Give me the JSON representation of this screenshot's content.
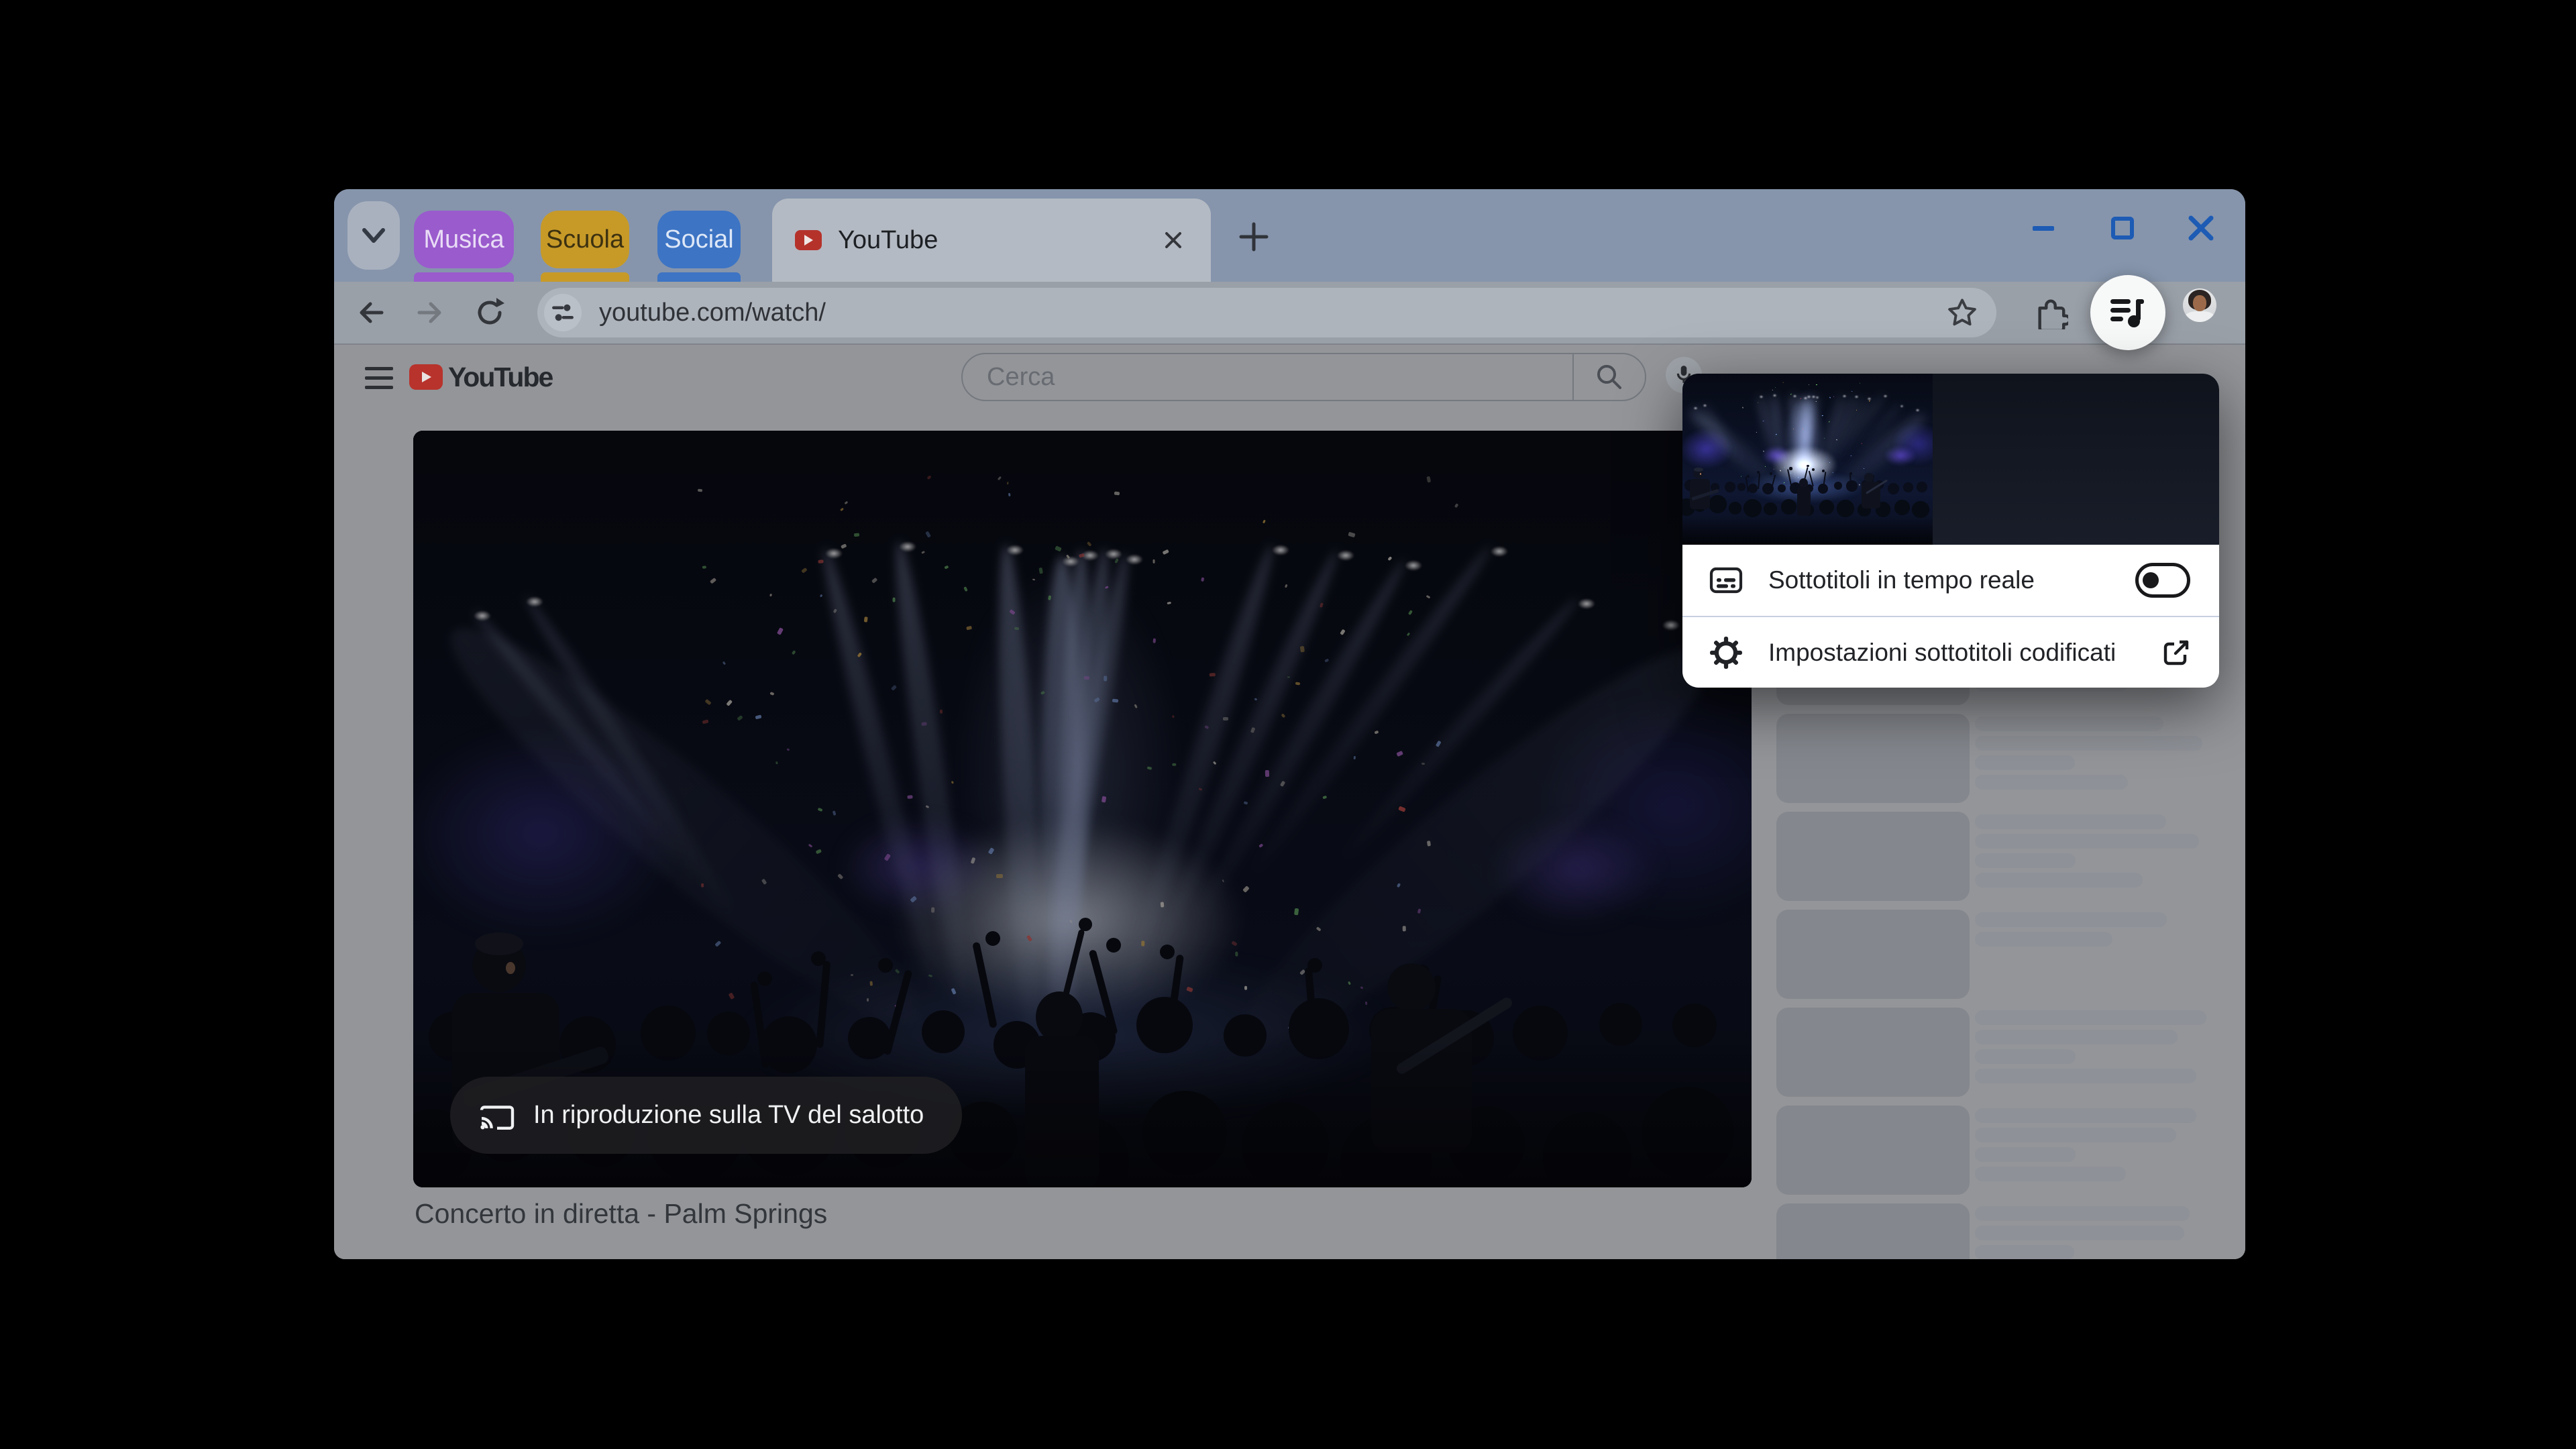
{
  "tabstrip": {
    "groups": [
      {
        "label": "Musica",
        "color": "#9a5bcd"
      },
      {
        "label": "Scuola",
        "color": "#c79a28"
      },
      {
        "label": "Social",
        "color": "#3d74c4"
      }
    ],
    "active_tab": {
      "label": "YouTube",
      "favicon": "youtube-icon"
    }
  },
  "window_controls": {
    "color": "#1d5bb4",
    "icons": [
      "minimize-icon",
      "maximize-icon",
      "close-icon"
    ]
  },
  "toolbar": {
    "url": "youtube.com/watch/",
    "icons": [
      "back-icon",
      "forward-icon",
      "reload-icon",
      "tune-icon",
      "star-icon",
      "extensions-icon",
      "playlist-music-icon",
      "avatar"
    ]
  },
  "youtube": {
    "logo_text": "YouTube",
    "search_placeholder": "Cerca",
    "video_title": "Concerto in diretta - Palm Springs",
    "cast_overlay": "In riproduzione sulla TV del salotto"
  },
  "media_popup": {
    "controls": [
      "previous-track-icon",
      "play-icon",
      "next-track-icon",
      "picture-in-picture-icon"
    ],
    "rows": [
      {
        "icon": "live-captions-icon",
        "label": "Sottotitoli in tempo reale",
        "toggle": "off"
      },
      {
        "icon": "settings-gear-icon",
        "label": "Impostazioni sottotitoli codificati",
        "trailing_icon": "open-in-new-icon"
      }
    ]
  },
  "sidebar": {
    "items": [
      {
        "lines": [
          281,
          339,
          149,
          228
        ]
      },
      {
        "lines": [
          281,
          339,
          149,
          228
        ]
      },
      {
        "lines": [
          285,
          334,
          150,
          250
        ]
      },
      {
        "lines": [
          286,
          205
        ]
      },
      {
        "lines": [
          345,
          302,
          150,
          330
        ]
      },
      {
        "lines": [
          330,
          300,
          150,
          225
        ]
      },
      {
        "lines": [
          320,
          312,
          148,
          230
        ]
      }
    ]
  },
  "art": {
    "beam_color": "#c3d3ff",
    "confetti_palette": [
      "#efe9dc",
      "#d9524a",
      "#74c46e",
      "#e2b14f",
      "#86a9e8",
      "#cfc6b8",
      "#b86bd1"
    ]
  }
}
